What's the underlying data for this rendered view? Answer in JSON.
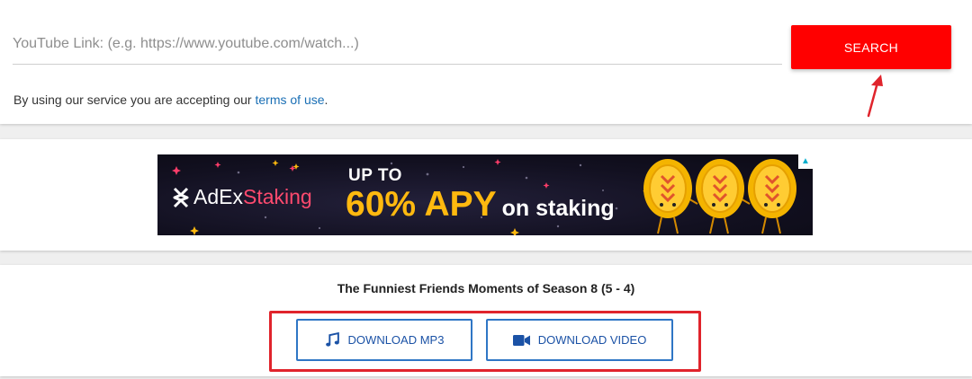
{
  "search": {
    "placeholder": "YouTube Link: (e.g. https://www.youtube.com/watch...)",
    "button_label": "SEARCH",
    "terms_prefix": "By using our service you are accepting our ",
    "terms_link": "terms of use",
    "terms_suffix": "."
  },
  "ad": {
    "brand": "AdEx",
    "brand_suffix": "Staking",
    "headline_small": "UP TO",
    "headline_big": "60% APY",
    "headline_sub": "on staking"
  },
  "result": {
    "title": "The Funniest Friends Moments of Season 8 (5 - 4)",
    "download_mp3_label": "DOWNLOAD MP3",
    "download_video_label": "DOWNLOAD VIDEO"
  },
  "icons": {
    "music": "music-note-icon",
    "video": "video-camera-icon",
    "ad_info": "ad-info-icon",
    "logo_mark": "adex-logo-icon"
  },
  "colors": {
    "accent_red": "#ff0000",
    "link_blue": "#1a6fb5",
    "download_blue": "#1b52a6",
    "highlight_red": "#e0242c",
    "ad_gold": "#ffb90f"
  }
}
